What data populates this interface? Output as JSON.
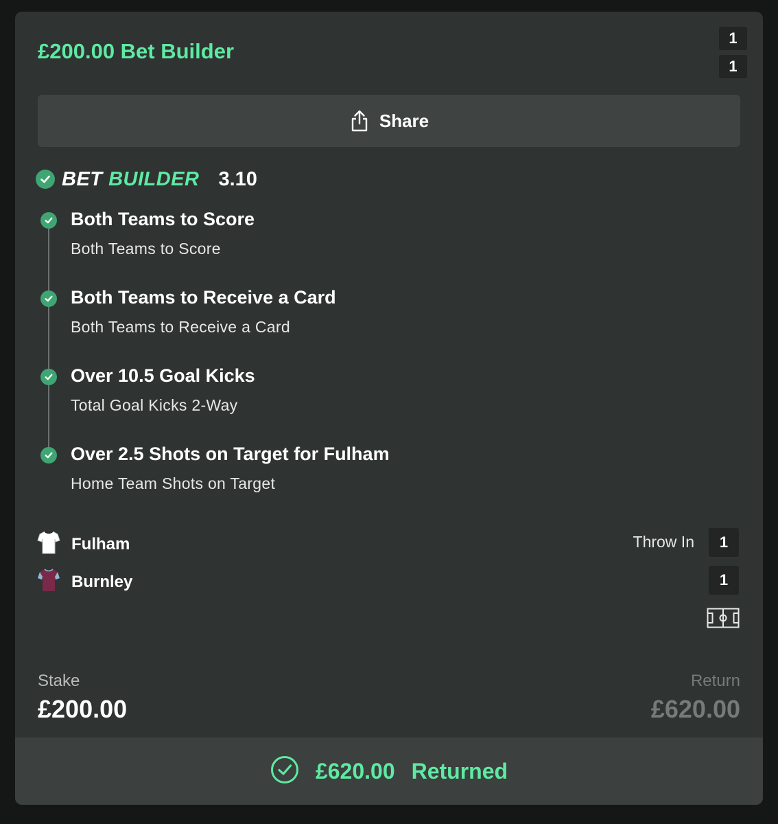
{
  "header": {
    "title": "£200.00 Bet Builder",
    "score_top": "1",
    "score_bottom": "1"
  },
  "share": {
    "label": "Share",
    "icon": "share-icon"
  },
  "bet_builder": {
    "logo_word_1": "BET",
    "logo_word_2": "BUILDER",
    "odds": "3.10"
  },
  "selections": [
    {
      "title": "Both Teams to Score",
      "market": "Both Teams to Score"
    },
    {
      "title": "Both Teams to Receive a Card",
      "market": "Both Teams to Receive a Card"
    },
    {
      "title": "Over 10.5 Goal Kicks",
      "market": "Total Goal Kicks 2-Way"
    },
    {
      "title": "Over 2.5 Shots on Target for Fulham",
      "market": "Home Team Shots on Target"
    }
  ],
  "match": {
    "home": {
      "name": "Fulham",
      "score": "1",
      "shirt_color": "#ffffff"
    },
    "away": {
      "name": "Burnley",
      "score": "1",
      "shirt_color": "#7a2948"
    },
    "status": "Throw In"
  },
  "stake": {
    "label": "Stake",
    "value": "£200.00"
  },
  "return": {
    "label": "Return",
    "value": "£620.00"
  },
  "footer": {
    "amount": "£620.00",
    "status": "Returned"
  },
  "colors": {
    "accent": "#5eeaa3",
    "check": "#3fa673",
    "card": "#2f3332",
    "background": "#151716"
  }
}
